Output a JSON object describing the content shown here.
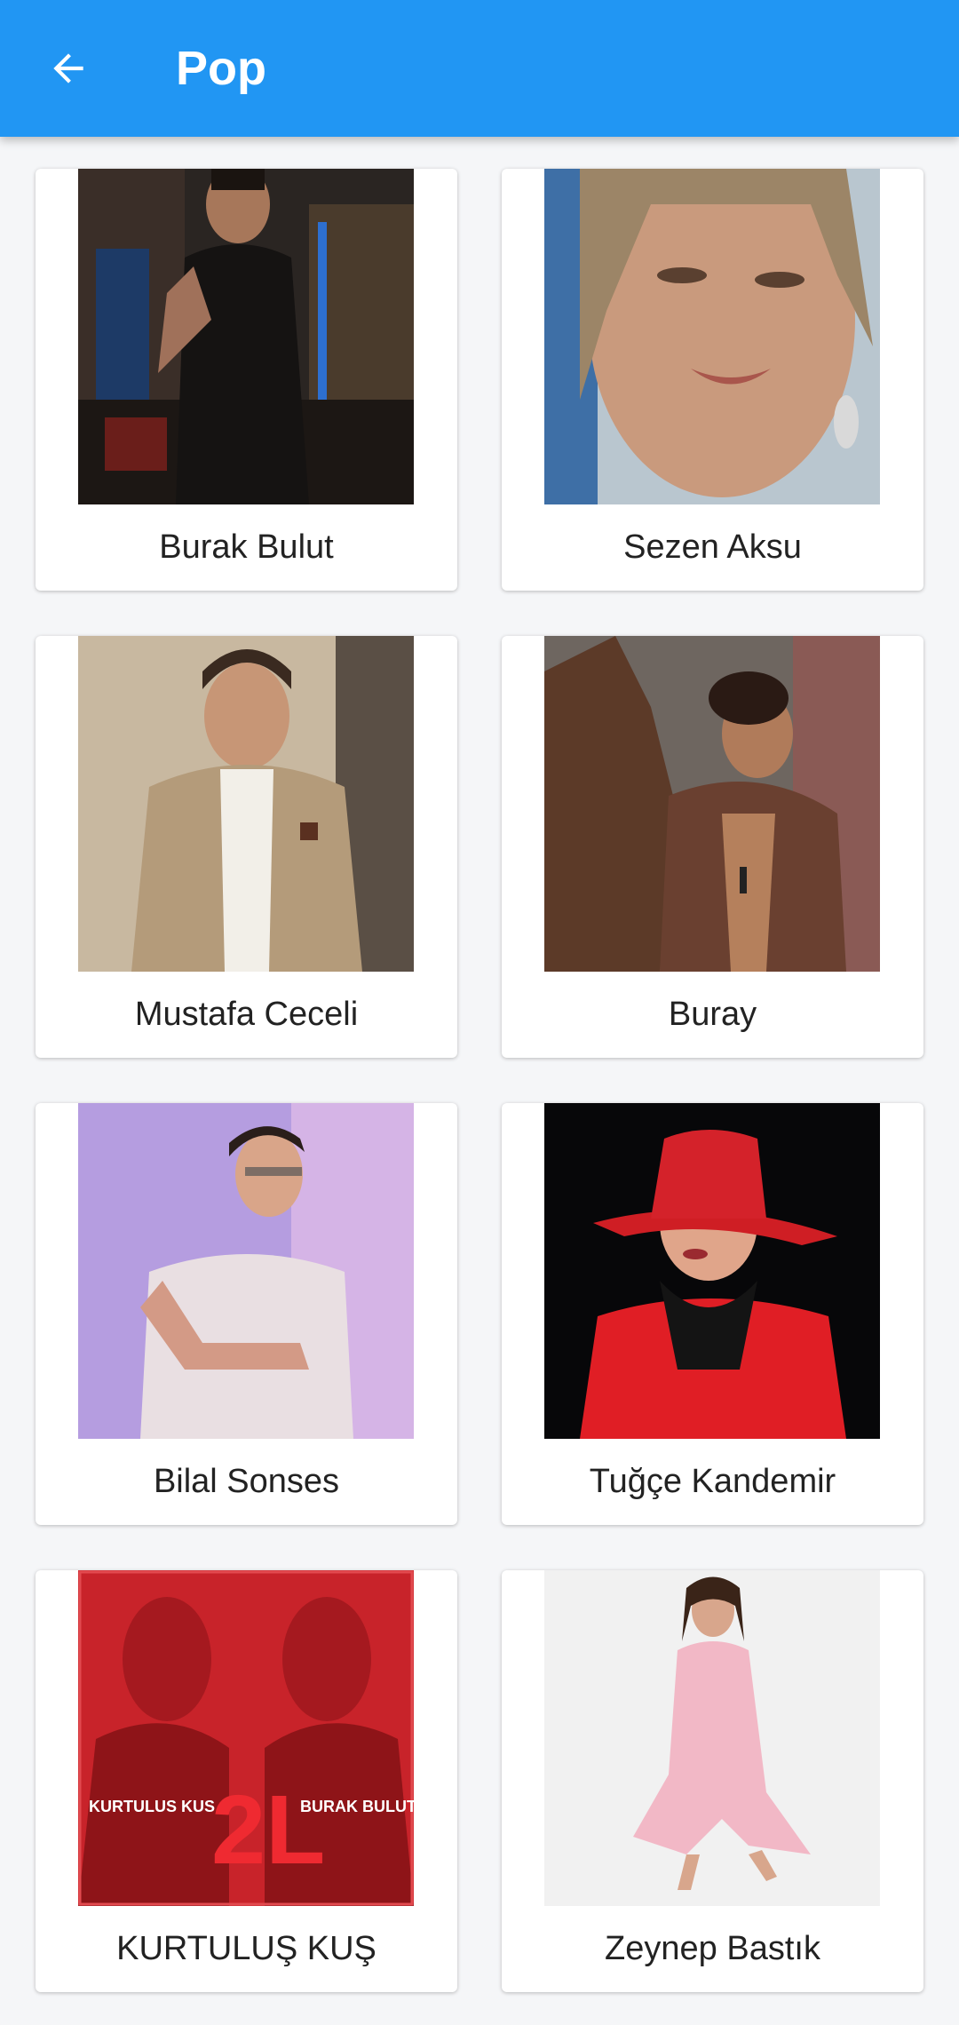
{
  "app_bar": {
    "title": "Pop",
    "back_icon": "arrow-back-icon"
  },
  "colors": {
    "app_bar": "#2196f3",
    "background": "#f5f6f8",
    "card": "#ffffff"
  },
  "artists": [
    {
      "name": "Burak Bulut"
    },
    {
      "name": "Sezen Aksu"
    },
    {
      "name": "Mustafa Ceceli"
    },
    {
      "name": "Buray"
    },
    {
      "name": "Bilal Sonses"
    },
    {
      "name": "Tuğçe Kandemir"
    },
    {
      "name": "KURTULUŞ KUŞ"
    },
    {
      "name": "Zeynep Bastık"
    }
  ],
  "album_art": {
    "left_text": "KURTULUS KUS",
    "center_text": "2L",
    "right_text": "BURAK BULUT"
  }
}
